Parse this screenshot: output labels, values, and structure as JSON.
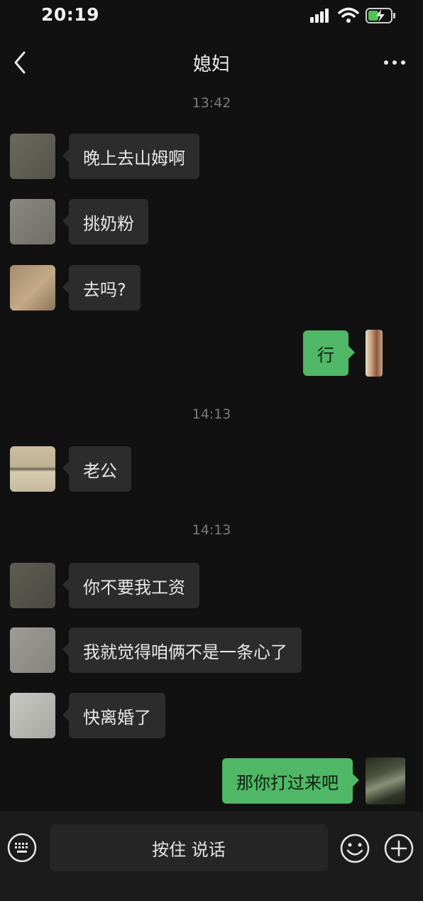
{
  "status_bar": {
    "time": "20:19"
  },
  "header": {
    "title": "媳妇"
  },
  "messages": {
    "stamp_1": "13:42",
    "m1": "晚上去山姆啊",
    "m2": "挑奶粉",
    "m3": "去吗?",
    "m4": "行",
    "stamp_2": "14:13",
    "m5": "老公",
    "stamp_3": "14:13",
    "m6": "你不要我工资",
    "m7": "我就觉得咱俩不是一条心了",
    "m8": "快离婚了",
    "m9": "那你打过来吧"
  },
  "input_bar": {
    "hold_to_talk": "按住 说话"
  },
  "colors": {
    "background": "#111111",
    "incoming_bubble": "#2c2c2c",
    "outgoing_bubble": "#4fb765"
  },
  "icons": [
    "signal-icon",
    "wifi-icon",
    "battery-charging-icon",
    "back-icon",
    "more-icon",
    "keyboard-icon",
    "emoji-icon",
    "plus-icon"
  ]
}
